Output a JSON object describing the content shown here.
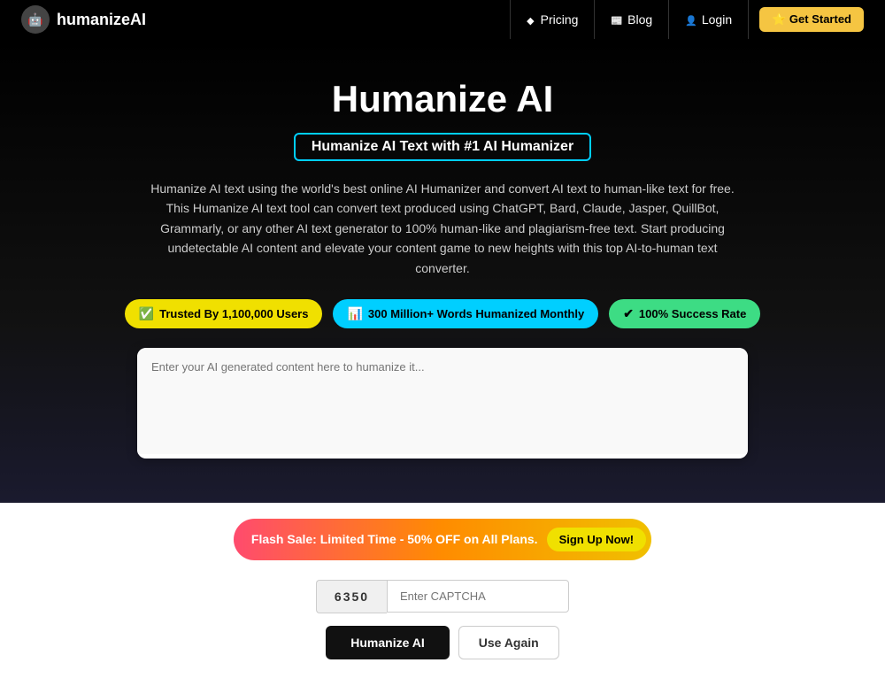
{
  "nav": {
    "logo_text": "humanizeAI",
    "logo_icon": "🤖",
    "links": [
      {
        "id": "pricing",
        "label": "Pricing",
        "icon": "diamond"
      },
      {
        "id": "blog",
        "label": "Blog",
        "icon": "blog"
      },
      {
        "id": "login",
        "label": "Login",
        "icon": "user"
      }
    ],
    "cta_label": "⭐ Get Started"
  },
  "hero": {
    "title": "Humanize AI",
    "subtitle": "Humanize AI Text with #1 AI Humanizer",
    "description": "Humanize AI text using the world's best online AI Humanizer and convert AI text to human-like text for free. This Humanize AI text tool can convert text produced using ChatGPT, Bard, Claude, Jasper, QuillBot, Grammarly, or any other AI text generator to 100% human-like and plagiarism-free text. Start producing undetectable AI content and elevate your content game to new heights with this top AI-to-human text converter.",
    "badges": [
      {
        "id": "users",
        "icon": "check",
        "label": "Trusted By 1,100,000 Users",
        "style": "yellow"
      },
      {
        "id": "words",
        "icon": "chart",
        "label": "300 Million+ Words Humanized Monthly",
        "style": "cyan"
      },
      {
        "id": "success",
        "icon": "check",
        "label": "100% Success Rate",
        "style": "green"
      }
    ]
  },
  "textarea": {
    "placeholder": "Enter your AI generated content here to humanize it..."
  },
  "flash_sale": {
    "text": "Flash Sale: Limited Time - 50% OFF on All Plans.",
    "btn_label": "Sign Up Now!"
  },
  "captcha": {
    "value": "6350",
    "input_placeholder": "Enter CAPTCHA"
  },
  "buttons": {
    "humanize_label": "Humanize AI",
    "use_again_label": "Use Again"
  }
}
